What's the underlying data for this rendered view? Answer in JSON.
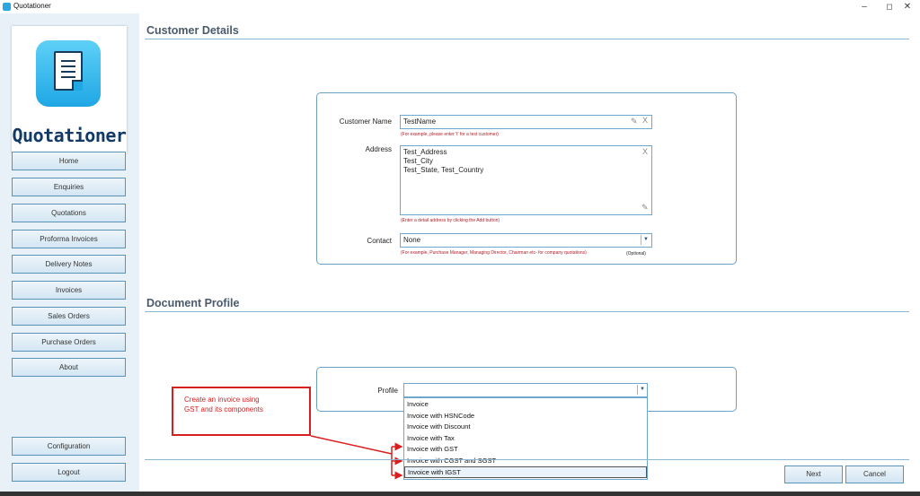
{
  "window": {
    "title": "Quotationer",
    "controls": {
      "minimize": "–",
      "maximize": "◻",
      "close": "✕"
    }
  },
  "sidebar": {
    "logo_text": "Quotationer",
    "nav": [
      {
        "label": "Home"
      },
      {
        "label": "Enquiries"
      },
      {
        "label": "Quotations"
      },
      {
        "label": "Proforma Invoices"
      },
      {
        "label": "Delivery Notes"
      },
      {
        "label": "Invoices"
      },
      {
        "label": "Sales Orders"
      },
      {
        "label": "Purchase Orders"
      },
      {
        "label": "About"
      }
    ],
    "bottom": {
      "configuration": "Configuration",
      "logout": "Logout"
    }
  },
  "customer_details": {
    "title": "Customer Details",
    "customer_name": {
      "label": "Customer Name",
      "value": "TestName",
      "hint": "(For example, please enter 't' for a test customer)"
    },
    "address": {
      "label": "Address",
      "lines": [
        "Test_Address",
        "Test_City",
        "Test_State, Test_Country"
      ],
      "hint": "(Enter a detail address by clicking the Add button)"
    },
    "contact": {
      "label": "Contact",
      "value": "None",
      "hint": "(For example, Purchase Manager, Managing Director, Chairman etc- for company quotations)",
      "optional": "(Optional)"
    }
  },
  "document_profile": {
    "title": "Document Profile",
    "profile_label": "Profile",
    "profile_value": "",
    "options": [
      "Invoice",
      "Invoice with HSNCode",
      "Invoice with Discount",
      "Invoice with Tax",
      "Invoice with GST",
      "Invoice with CGST and SGST",
      "Invoice with IGST"
    ],
    "selected_index": 6
  },
  "annotation": {
    "lines": [
      "Create an invoice using",
      "GST and its components"
    ],
    "color": "#d81e1e"
  },
  "actions": {
    "next": "Next",
    "cancel": "Cancel"
  },
  "icons": {
    "pencil": "pencil-icon",
    "clear": "clear-icon",
    "dropdown": "chevron-down-icon"
  }
}
